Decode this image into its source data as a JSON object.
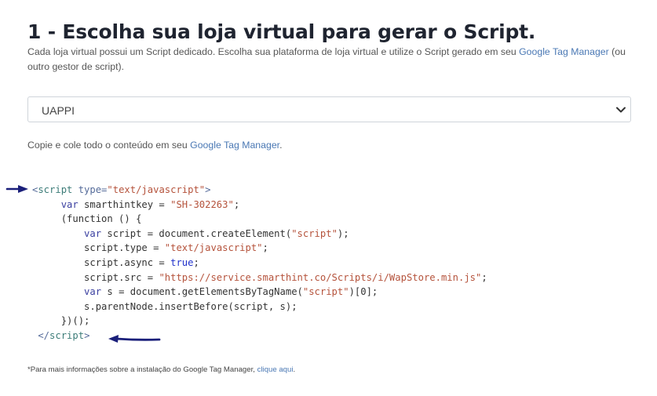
{
  "heading": "1 - Escolha sua loja virtual para gerar o Script.",
  "description": {
    "text_before": "Cada loja virtual possui um Script dedicado. Escolha sua plataforma de loja virtual e utilize o Script gerado em seu ",
    "link": "Google Tag Manager",
    "text_after": " (ou outro gestor de script)."
  },
  "platform_select": {
    "selected": "UAPPI",
    "icon": "chevron-down-icon"
  },
  "copy_instruction": {
    "text_before": "Copie e cole todo o conteúdo em seu ",
    "link": "Google Tag Manager",
    "text_after": "."
  },
  "code": {
    "open_tag_lt": "<",
    "open_tag_name": "script",
    "open_attr": " type=",
    "open_attr_value": "\"text/javascript\"",
    "open_tag_gt": ">",
    "line2_kw": "var",
    "line2_name": " smarthintkey = ",
    "line2_value": "\"SH-302263\"",
    "line2_end": ";",
    "line3": "(function () {",
    "line4_kw": "var",
    "line4_mid": " script = document.createElement(",
    "line4_value": "\"script\"",
    "line4_end": ");",
    "line5_mid": "script.type = ",
    "line5_value": "\"text/javascript\"",
    "line5_end": ";",
    "line6_mid": "script.async = ",
    "line6_value": "true",
    "line6_end": ";",
    "line7_mid": "script.src = ",
    "line7_value": "\"https://service.smarthint.co/Scripts/i/WapStore.min.js\"",
    "line7_end": ";",
    "line8_kw": "var",
    "line8_mid": " s = document.getElementsByTagName(",
    "line8_value": "\"script\"",
    "line8_end": ")[0];",
    "line9": "s.parentNode.insertBefore(script, s);",
    "line10": "})();",
    "close_tag_lt": "</",
    "close_tag_name": "script",
    "close_tag_gt": ">"
  },
  "annotations": {
    "arrow_color": "#1a1f7a"
  },
  "footnote": {
    "text_before": "*Para mais informações sobre a instalação do Google Tag Manager, ",
    "link": "clique aqui",
    "text_after": "."
  }
}
